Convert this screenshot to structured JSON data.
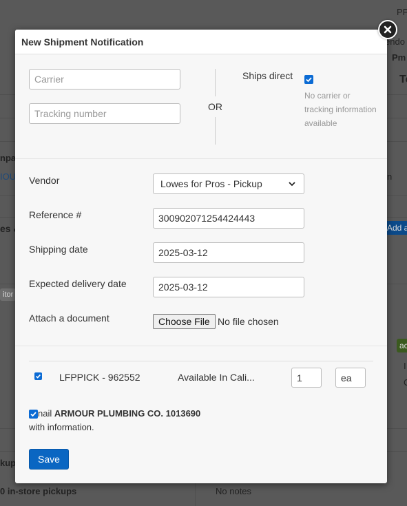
{
  "background": {
    "fragments": [
      "PP",
      "endo",
      "Pm",
      "Te",
      "npa",
      "IOU",
      "n",
      "es &",
      "Add a",
      "itor",
      "ac",
      "I",
      "C",
      "kup",
      "0 in-store pickups",
      "No notes"
    ]
  },
  "modal": {
    "title": "New Shipment Notification",
    "carrier_placeholder": "Carrier",
    "tracking_placeholder": "Tracking number",
    "or_label": "OR",
    "ships_direct_label": "Ships direct",
    "ships_direct_checked": true,
    "ships_direct_note_1": "No carrier or",
    "ships_direct_note_2": "tracking information",
    "ships_direct_note_3": "available",
    "vendor_label": "Vendor",
    "vendor_value": "Lowes for Pros - Pickup",
    "reference_label": "Reference #",
    "reference_value": "300902071254424443",
    "shipping_date_label": "Shipping date",
    "shipping_date_value": "2025-03-12",
    "delivery_date_label": "Expected delivery date",
    "delivery_date_value": "2025-03-12",
    "attach_label": "Attach a document",
    "choose_file_label": "Choose File",
    "no_file_label": "No file chosen",
    "line_item": {
      "checked": true,
      "sku": "LFPPICK - 962552",
      "availability": "Available In Cali...",
      "quantity": "1",
      "unit": "ea"
    },
    "email_checked": true,
    "email_prefix": "nail",
    "email_recipient": "ARMOUR PLUMBING CO. 1013690",
    "email_suffix": "with information.",
    "save_label": "Save"
  },
  "colors": {
    "accent": "#0a66c2",
    "overlay": "#595959"
  },
  "icons": {
    "close": "close-icon",
    "select": "chevron-down-icon",
    "check": "check-icon"
  }
}
